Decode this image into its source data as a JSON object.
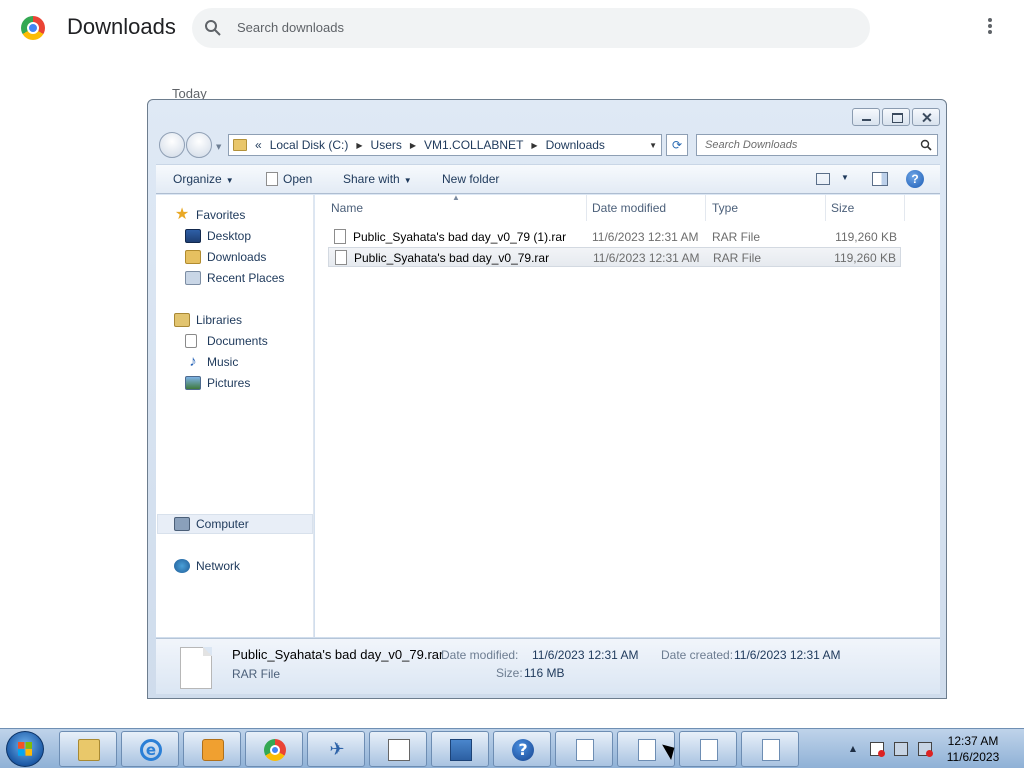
{
  "chrome": {
    "title": "Downloads",
    "search_placeholder": "Search downloads",
    "section_label": "Today"
  },
  "explorer": {
    "address": {
      "chevron": "«",
      "segments": [
        "Local Disk (C:)",
        "Users",
        "VM1.COLLABNET",
        "Downloads"
      ]
    },
    "search_placeholder": "Search Downloads",
    "toolbar": {
      "organize": "Organize",
      "open": "Open",
      "share_with": "Share with",
      "new_folder": "New folder",
      "help": "?"
    },
    "nav": {
      "favorites": "Favorites",
      "desktop": "Desktop",
      "downloads": "Downloads",
      "recent_places": "Recent Places",
      "libraries": "Libraries",
      "documents": "Documents",
      "music": "Music",
      "pictures": "Pictures",
      "computer": "Computer",
      "network": "Network"
    },
    "columns": {
      "name": "Name",
      "date_modified": "Date modified",
      "type": "Type",
      "size": "Size"
    },
    "files": [
      {
        "name": "Public_Syahata's bad day_v0_79 (1).rar",
        "date": "11/6/2023 12:31 AM",
        "type": "RAR File",
        "size": "119,260 KB"
      },
      {
        "name": "Public_Syahata's bad day_v0_79.rar",
        "date": "11/6/2023 12:31 AM",
        "type": "RAR File",
        "size": "119,260 KB"
      }
    ],
    "details": {
      "name": "Public_Syahata's bad day_v0_79.rar",
      "type": "RAR File",
      "date_modified_label": "Date modified:",
      "date_modified": "11/6/2023 12:31 AM",
      "date_created_label": "Date created:",
      "date_created": "11/6/2023 12:31 AM",
      "size_label": "Size:",
      "size": "116 MB"
    }
  },
  "taskbar": {
    "clock_time": "12:37 AM",
    "clock_date": "11/6/2023"
  }
}
